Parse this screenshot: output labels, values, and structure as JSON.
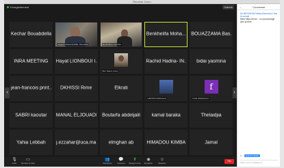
{
  "app": {
    "window_title": "Réunion Zoom"
  },
  "header": {
    "recording_label": "Enregistrement",
    "view_label": "Galerie"
  },
  "tiles": [
    {
      "name": "Kechar Bouabdellah"
    },
    {
      "sub": "Lafyaou Hicham(UPM) -Taroudant"
    },
    {
      "sub": "Mouhiddine Lamrani"
    },
    {
      "name": "Benkhelifa Moha..."
    },
    {
      "name": "BOUAZZAMA Bas..."
    },
    {
      "name": "INRA MEETING"
    },
    {
      "name": "Hayat LIONBOUI I..."
    },
    {
      "sub": "Ben Salem Anna"
    },
    {
      "name": "Rachid Hadria- IN..."
    },
    {
      "name": "bidai yasmina"
    },
    {
      "name": "jean-francois print..."
    },
    {
      "name": "DKHISSI Rime"
    },
    {
      "name": "Elkrati"
    },
    {
      "sub": "HAROUN Mohamed"
    },
    {
      "sub": "Farid Abdelhamid",
      "avatar_letter": "f"
    },
    {
      "name": "SABRI kaoutar"
    },
    {
      "name": "MANAL ELJOUADI"
    },
    {
      "name": "Boutarfa abdeljalil"
    },
    {
      "name": "kamal baraka"
    },
    {
      "name": "Thelaidjia"
    },
    {
      "name": "Yahia Lebbah"
    },
    {
      "name": "j.ezzahar@uca.ma"
    },
    {
      "name": "elmghari ab"
    },
    {
      "name": "HIMADOU KIMBA"
    },
    {
      "name": "Jamal"
    }
  ],
  "toolbar": {
    "items": [
      {
        "label": "Audio"
      },
      {
        "label": "Démarrer la vidéo"
      },
      {
        "label": "Participants"
      },
      {
        "label": "Converser"
      },
      {
        "label": "Partager l'écran"
      },
      {
        "label": "Enregistrer"
      },
      {
        "label": "Réactions"
      }
    ],
    "end_label": "Fin"
  },
  "chat": {
    "title": "Converser",
    "sender": "De BENYAHIA Fatiha (Nommé) à Tout le monde :",
    "message": "Meet https://meet... un pourcentage plus proche",
    "to_label": "À :",
    "to_value": "Tout le monde",
    "input_placeholder": "Tapez votre message ici..."
  },
  "colors": {
    "active_speaker": "#c8e33a",
    "end_button": "#e02828",
    "recording_dot": "#2fbf4a",
    "chat_accent": "#2d8cff"
  }
}
